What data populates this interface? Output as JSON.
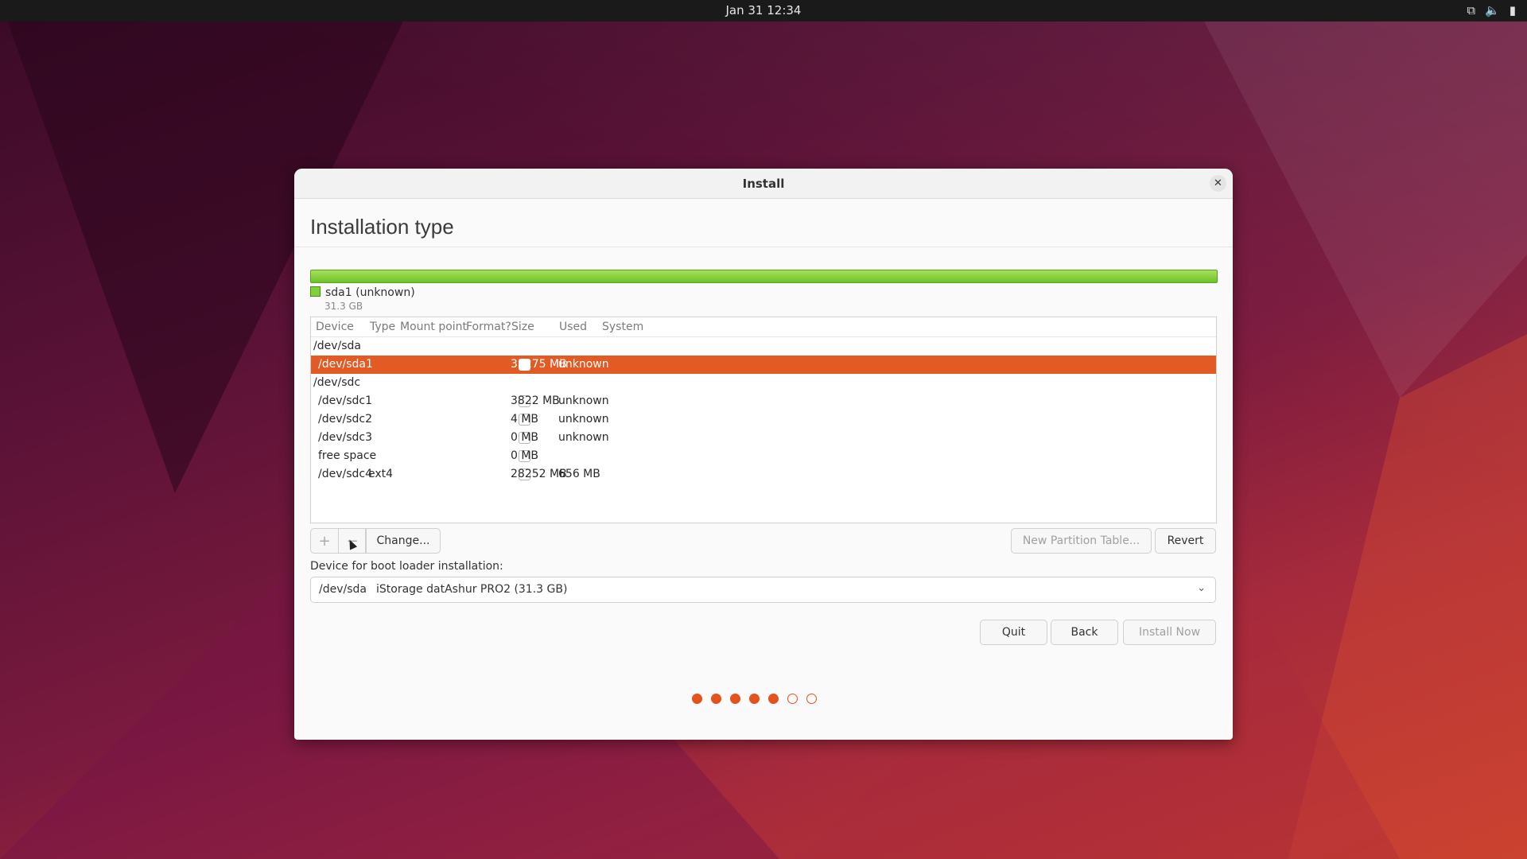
{
  "topbar": {
    "datetime": "Jan 31  12:34",
    "icons": [
      "network-icon",
      "volume-icon",
      "battery-icon"
    ]
  },
  "window": {
    "title": "Install",
    "heading": "Installation type",
    "disk": {
      "legend_label": "sda1 (unknown)",
      "legend_size": "31.3 GB",
      "bar_color": "#7ed13a"
    },
    "table": {
      "columns": [
        "Device",
        "Type",
        "Mount point",
        "Format?",
        "Size",
        "Used",
        "System"
      ],
      "rows": [
        {
          "device": "/dev/sda",
          "type": "",
          "size": "",
          "used": "",
          "checkbox": false,
          "group": true
        },
        {
          "device": "/dev/sda1",
          "type": "",
          "size": "31275 MB",
          "used": "unknown",
          "checkbox": true,
          "selected": true
        },
        {
          "device": "/dev/sdc",
          "type": "",
          "size": "",
          "used": "",
          "checkbox": false,
          "group": true
        },
        {
          "device": "/dev/sdc1",
          "type": "",
          "size": "3822 MB",
          "used": "unknown",
          "checkbox": true
        },
        {
          "device": "/dev/sdc2",
          "type": "",
          "size": "4 MB",
          "used": "unknown",
          "checkbox": true
        },
        {
          "device": "/dev/sdc3",
          "type": "",
          "size": "0 MB",
          "used": "unknown",
          "checkbox": true
        },
        {
          "device": "free space",
          "type": "",
          "size": "0 MB",
          "used": "",
          "checkbox": true
        },
        {
          "device": "/dev/sdc4",
          "type": "ext4",
          "size": "28252 MB",
          "used": "656 MB",
          "checkbox": true
        }
      ]
    },
    "buttons": {
      "add": "+",
      "remove": "−",
      "change": "Change...",
      "new_partition_table": "New Partition Table...",
      "revert": "Revert",
      "quit": "Quit",
      "back": "Back",
      "install_now": "Install Now"
    },
    "boot_loader": {
      "label": "Device for boot loader installation:",
      "device": "/dev/sda",
      "description": "iStorage datAshur PRO2 (31.3 GB)"
    },
    "progress": {
      "total_steps": 7,
      "completed_steps": 5
    }
  },
  "colors": {
    "accent": "#e2531f",
    "selected_row": "#e25a24",
    "disk_green": "#7ed13a"
  }
}
